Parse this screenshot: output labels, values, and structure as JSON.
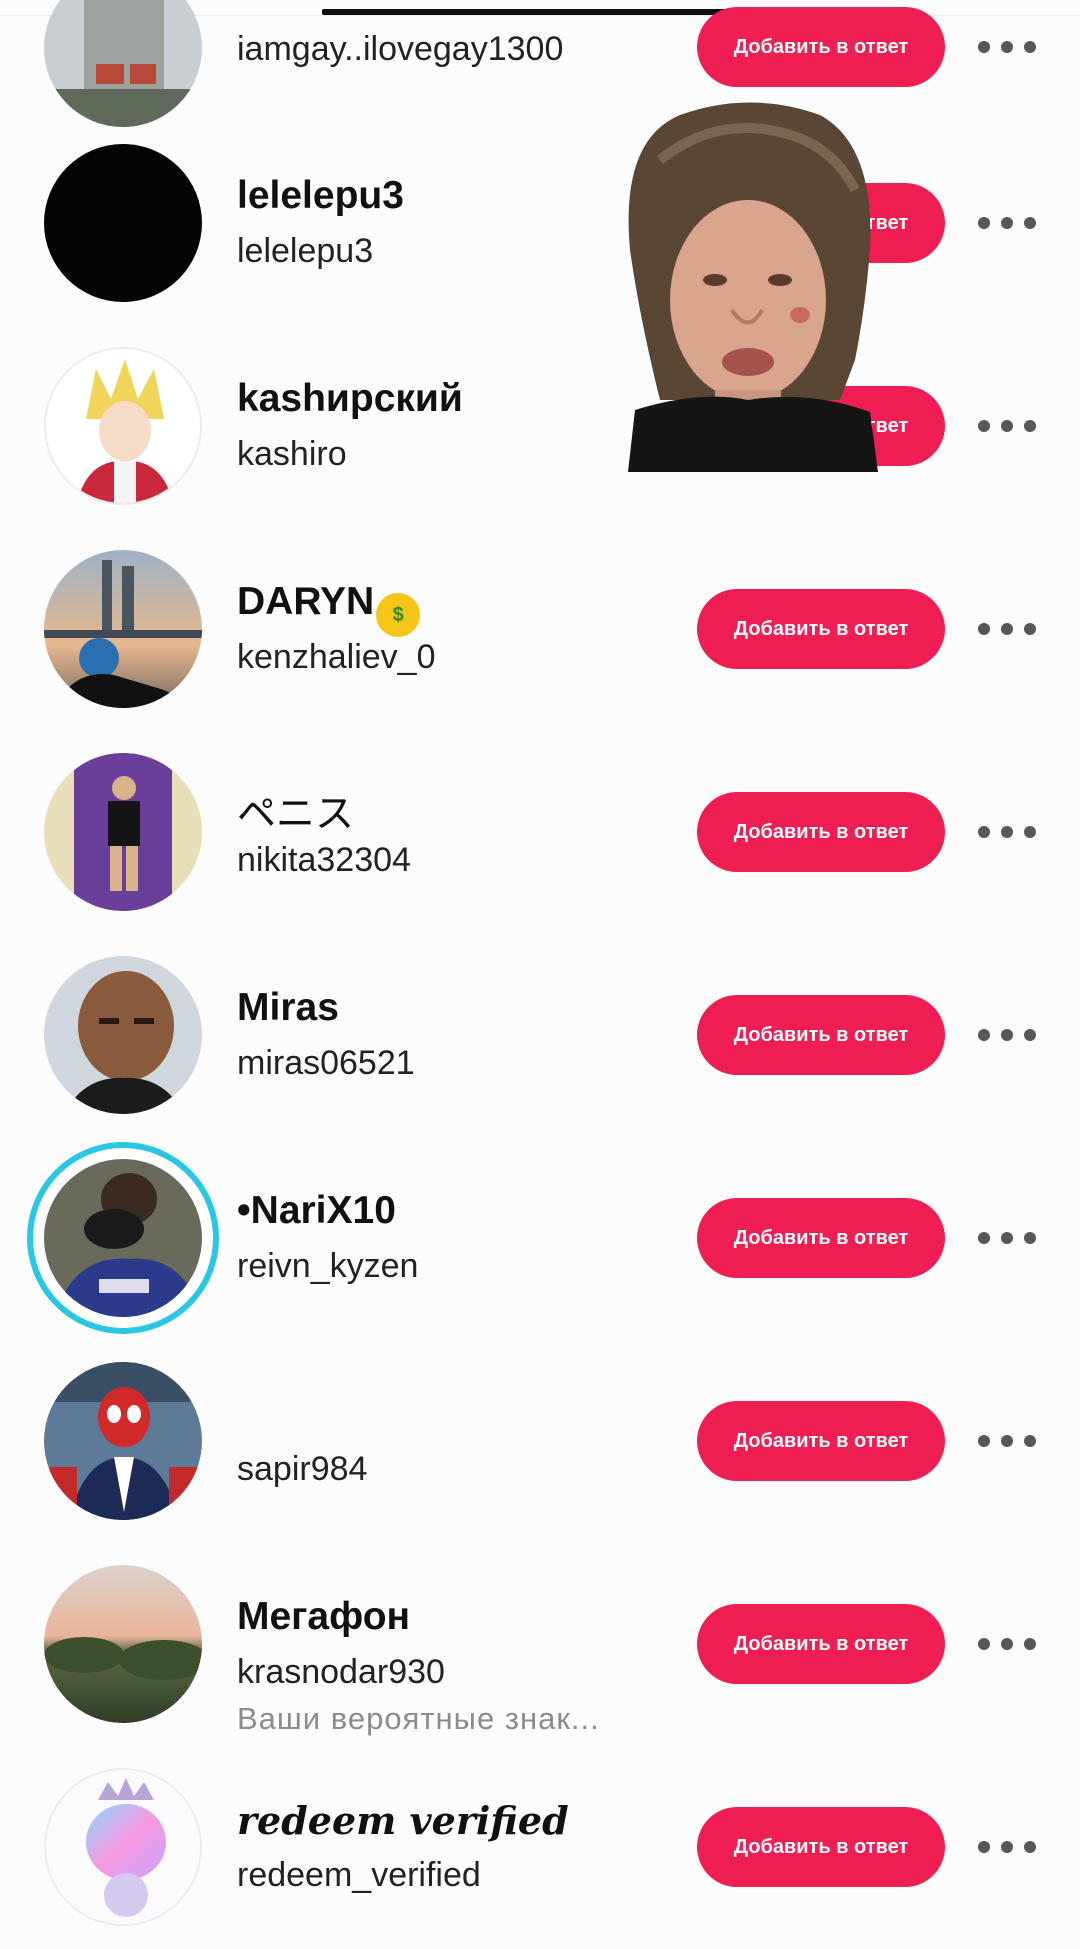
{
  "accent_color": "#ee1d52",
  "story_ring_color": "#2ac7e4",
  "users": [
    {
      "name": "",
      "handle": "iamgay..ilovegay1300",
      "subtitle": "",
      "add_button": "Добавить в ответ",
      "more_icon": "more-horizontal-icon",
      "avatar": "building-balcony-photo"
    },
    {
      "name": "lelelepu3",
      "handle": "lelelepu3",
      "subtitle": "",
      "add_button": "Добавить в ответ",
      "more_icon": "more-horizontal-icon",
      "avatar": "black-circle"
    },
    {
      "name": "kashирский",
      "handle": "kashiro",
      "subtitle": "",
      "add_button": "Добавить в ответ",
      "more_icon": "more-horizontal-icon",
      "avatar": "anime-blond-character"
    },
    {
      "name": "DARYN",
      "name_emoji": "money-mouth-face-emoji",
      "handle": "kenzhaliev_0",
      "subtitle": "",
      "add_button": "Добавить в ответ",
      "more_icon": "more-horizontal-icon",
      "avatar": "city-sunset-photo"
    },
    {
      "name": "ペニス",
      "handle": "nikita32304",
      "subtitle": "",
      "add_button": "Добавить в ответ",
      "more_icon": "more-horizontal-icon",
      "avatar": "mirror-selfie-purple-photo"
    },
    {
      "name": "Miras",
      "handle": "miras06521",
      "subtitle": "",
      "add_button": "Добавить в ответ",
      "more_icon": "more-horizontal-icon",
      "avatar": "bald-man-photo"
    },
    {
      "name": "•NariX10",
      "handle": "reivn_kyzen",
      "subtitle": "",
      "add_button": "Добавить в ответ",
      "more_icon": "more-horizontal-icon",
      "avatar": "football-player-photo",
      "has_story": true
    },
    {
      "name": "",
      "handle": "sapir984",
      "subtitle": "",
      "add_button": "Добавить в ответ",
      "more_icon": "more-horizontal-icon",
      "avatar": "spiderman-tuxedo-art"
    },
    {
      "name": "Мегафон",
      "handle": "krasnodar930",
      "subtitle": "Ваши вероятные знак...",
      "add_button": "Добавить в ответ",
      "more_icon": "more-horizontal-icon",
      "avatar": "trees-sky-photo"
    },
    {
      "name": "redeem verified",
      "handle": "redeem_verified",
      "subtitle": "",
      "add_button": "Добавить в ответ",
      "more_icon": "more-horizontal-icon",
      "avatar": "crowned-holographic-figure"
    }
  ],
  "overlay": {
    "icon": "person-face-overlay-photo"
  }
}
